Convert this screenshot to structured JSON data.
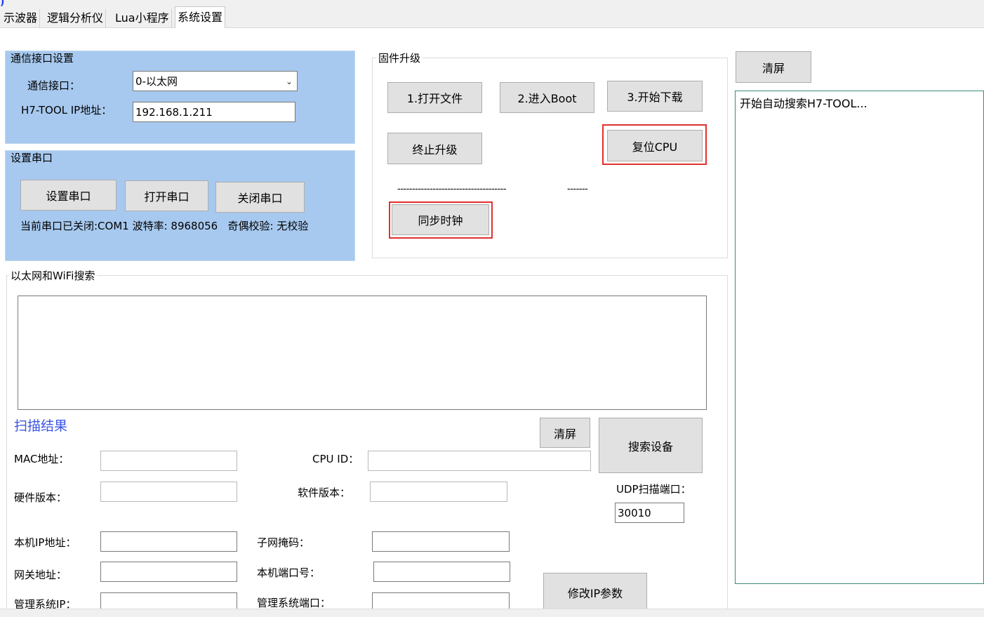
{
  "tabs": [
    "示波器",
    "逻辑分析仪",
    "Lua小程序",
    "系统设置"
  ],
  "comm": {
    "legend": "通信接口设置",
    "interface_label": "通信接口：",
    "interface_value": "0-以太网",
    "ip_label": "H7-TOOL IP地址：",
    "ip_value": "192.168.1.211"
  },
  "serial": {
    "legend": "设置串口",
    "set_label": "设置串口",
    "open_label": "打开串口",
    "close_label": "关闭串口",
    "status": "当前串口已关闭:COM1 波特率: 8968056   奇偶校验: 无校验"
  },
  "firmware": {
    "legend": "固件升级",
    "open_file": "1.打开文件",
    "enter_boot": "2.进入Boot",
    "start_download": "3.开始下载",
    "stop_upgrade": "终止升级",
    "reset_cpu": "复位CPU",
    "progress_left": "-------------------------------------",
    "progress_right": "-------",
    "sync_clock": "同步时钟"
  },
  "search": {
    "legend": "以太网和WiFi搜索",
    "scan_result": "扫描结果",
    "clear_label": "清屏",
    "search_label": "搜索设备",
    "mac_label": "MAC地址：",
    "cpuid_label": "CPU ID：",
    "hw_label": "硬件版本：",
    "sw_label": "软件版本：",
    "udp_label": "UDP扫描端口：",
    "udp_value": "30010",
    "localip_label": "本机IP地址：",
    "subnet_label": "子网掩码：",
    "gateway_label": "网关地址：",
    "localport_label": "本机端口号：",
    "mgmtip_label": "管理系统IP：",
    "mgmtport_label": "管理系统端口：",
    "modify_label": "修改IP参数"
  },
  "log": {
    "clear_label": "清屏",
    "text": "开始自动搜索H7-TOOL..."
  },
  "colors": {
    "panel_blue": "#a7c9ef",
    "highlight_red": "#e0302f",
    "scan_label_blue": "#3a55e6"
  }
}
